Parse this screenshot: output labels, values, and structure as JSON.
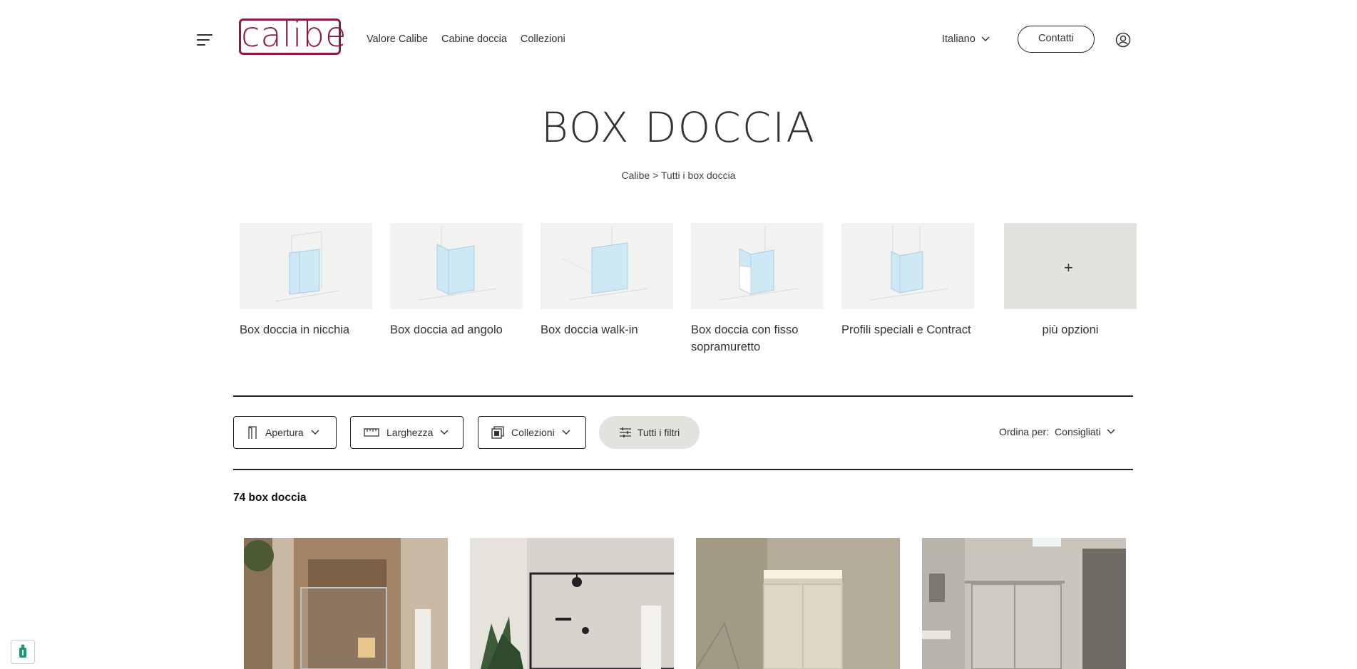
{
  "header": {
    "logo_text": "calibe",
    "nav": [
      "Valore Calibe",
      "Cabine doccia",
      "Collezioni"
    ],
    "language": "Italiano",
    "contact_label": "Contatti"
  },
  "page": {
    "title": "BOX DOCCIA",
    "breadcrumb": {
      "home": "Calibe",
      "separator": ">",
      "current": "Tutti i box doccia"
    }
  },
  "categories": [
    {
      "label": "Box doccia in nicchia"
    },
    {
      "label": "Box doccia ad angolo"
    },
    {
      "label": "Box doccia walk-in"
    },
    {
      "label": "Box doccia con fisso sopramuretto"
    },
    {
      "label": "Profili speciali e Contract"
    },
    {
      "label": "più opzioni"
    }
  ],
  "filters": {
    "opening": "Apertura",
    "width": "Larghezza",
    "collections": "Collezioni",
    "all": "Tutti i filtri",
    "sort_label": "Ordina per:",
    "sort_value": "Consigliati"
  },
  "results": {
    "count_text": "74 box doccia"
  },
  "colors": {
    "brand": "#8a1b45",
    "chip": "#e3e2dc",
    "thumb_bg": "#f2f2f2",
    "glass": "#cfe8f6"
  },
  "icons": [
    "hamburger-icon",
    "chevron-down-icon",
    "user-icon",
    "door-icon",
    "ruler-icon",
    "collection-icon",
    "sliders-icon",
    "plus-icon",
    "cookie-icon"
  ]
}
